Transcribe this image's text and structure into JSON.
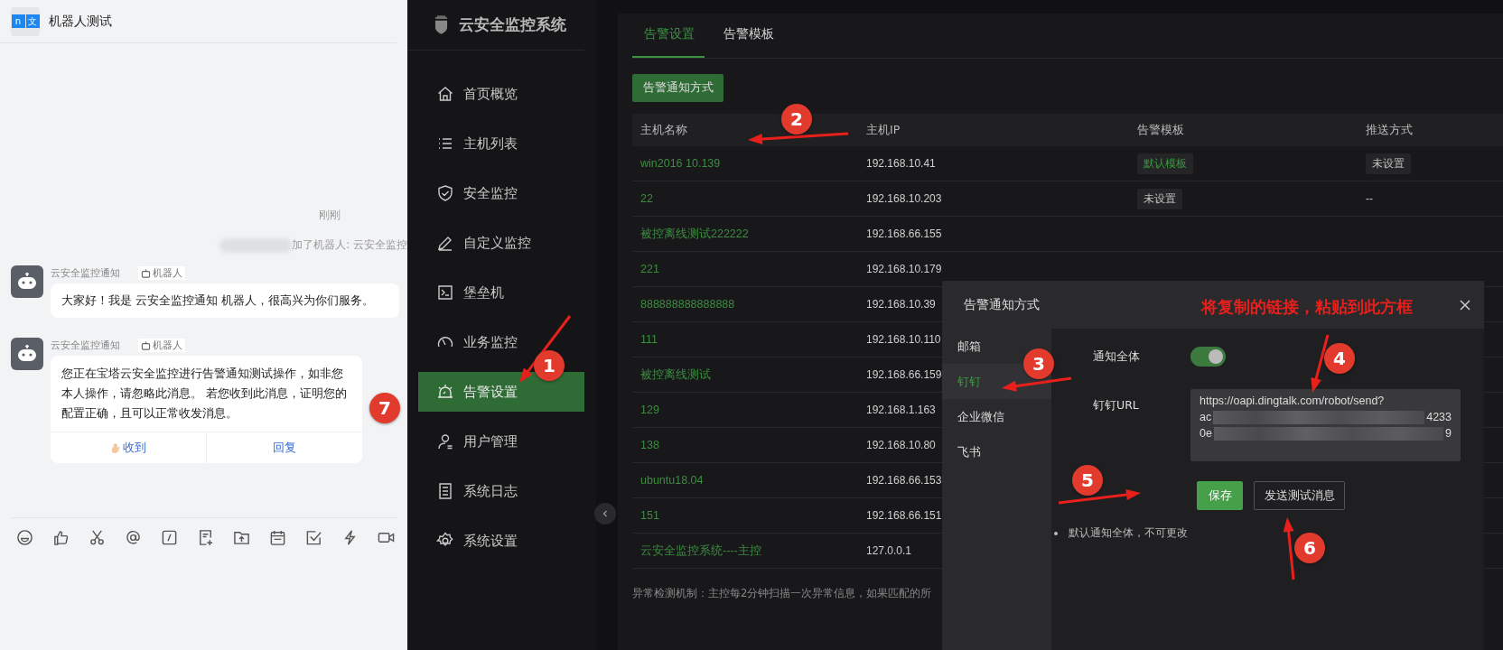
{
  "chat": {
    "title": "机器人测试",
    "logo_marks": [
      "n",
      "文"
    ],
    "timestamp": "刚刚",
    "system_notice": "加了机器人: 云安全监控",
    "messages": [
      {
        "sender": "云安全监控通知",
        "tag": "机器人",
        "text": "大家好！我是 云安全监控通知 机器人，很高兴为你们服务。"
      },
      {
        "sender": "云安全监控通知",
        "tag": "机器人",
        "text": "您正在宝塔云安全监控进行告警通知测试操作，如非您本人操作，请忽略此消息。 若您收到此消息，证明您的配置正确，且可以正常收发消息。",
        "actions": [
          {
            "label": "收到",
            "kind": "ack"
          },
          {
            "label": "回复",
            "kind": "reply"
          }
        ]
      }
    ]
  },
  "app": {
    "title": "云安全监控系统",
    "menu": [
      {
        "label": "首页概览",
        "selected": false
      },
      {
        "label": "主机列表",
        "selected": false
      },
      {
        "label": "安全监控",
        "selected": false
      },
      {
        "label": "自定义监控",
        "selected": false
      },
      {
        "label": "堡垒机",
        "selected": false
      },
      {
        "label": "业务监控",
        "selected": false
      },
      {
        "label": "告警设置",
        "selected": true
      },
      {
        "label": "用户管理",
        "selected": false
      },
      {
        "label": "系统日志",
        "selected": false
      },
      {
        "label": "系统设置",
        "selected": false
      }
    ],
    "tabs": [
      {
        "label": "告警设置",
        "selected": true
      },
      {
        "label": "告警模板",
        "selected": false
      }
    ],
    "action_button": "告警通知方式",
    "table": {
      "columns": [
        "主机名称",
        "主机IP",
        "告警模板",
        "推送方式"
      ],
      "rows": [
        {
          "name": "win2016 10.139",
          "ip": "192.168.10.41",
          "template": {
            "text": "默认模板",
            "kind": "default"
          },
          "push": {
            "text": "未设置",
            "kind": "unset"
          }
        },
        {
          "name": "22",
          "ip": "192.168.10.203",
          "template": {
            "text": "未设置",
            "kind": "unset"
          },
          "push": {
            "text": "--",
            "kind": "plain"
          }
        },
        {
          "name": "被控离线测试222222",
          "ip": "192.168.66.155"
        },
        {
          "name": "221",
          "ip": "192.168.10.179"
        },
        {
          "name": "888888888888888",
          "ip": "192.168.10.39"
        },
        {
          "name": "111",
          "ip": "192.168.10.110"
        },
        {
          "name": "被控离线测试",
          "ip": "192.168.66.159"
        },
        {
          "name": "129",
          "ip": "192.168.1.163"
        },
        {
          "name": "138",
          "ip": "192.168.10.80"
        },
        {
          "name": "ubuntu18.04",
          "ip": "192.168.66.153"
        },
        {
          "name": "151",
          "ip": "192.168.66.151"
        },
        {
          "name": "云安全监控系统----主控",
          "ip": "127.0.0.1"
        }
      ]
    },
    "footer_note": "异常检测机制：主控每2分钟扫描一次异常信息，如果匹配的所"
  },
  "dialog": {
    "title": "告警通知方式",
    "nav": [
      {
        "label": "邮箱",
        "selected": false
      },
      {
        "label": "钉钉",
        "selected": true
      },
      {
        "label": "企业微信",
        "selected": false
      },
      {
        "label": "飞书",
        "selected": false
      }
    ],
    "notify_all": {
      "label": "通知全体",
      "on": true
    },
    "url": {
      "label": "钉钉URL",
      "lines": [
        {
          "start": "https://oapi.dingtalk.com/robot/send?",
          "redacted": false
        },
        {
          "start": "ac",
          "end": "4233",
          "redacted": true
        },
        {
          "start": "0e",
          "end": "9",
          "redacted": true
        }
      ]
    },
    "buttons": [
      {
        "label": "保存",
        "kind": "primary"
      },
      {
        "label": "发送测试消息",
        "kind": "secondary"
      }
    ],
    "notes": [
      "默认通知全体，不可更改"
    ]
  },
  "annotations": {
    "note": "将复制的链接，粘贴到此方框",
    "badges": [
      "1",
      "2",
      "3",
      "4",
      "5",
      "6",
      "7"
    ]
  }
}
